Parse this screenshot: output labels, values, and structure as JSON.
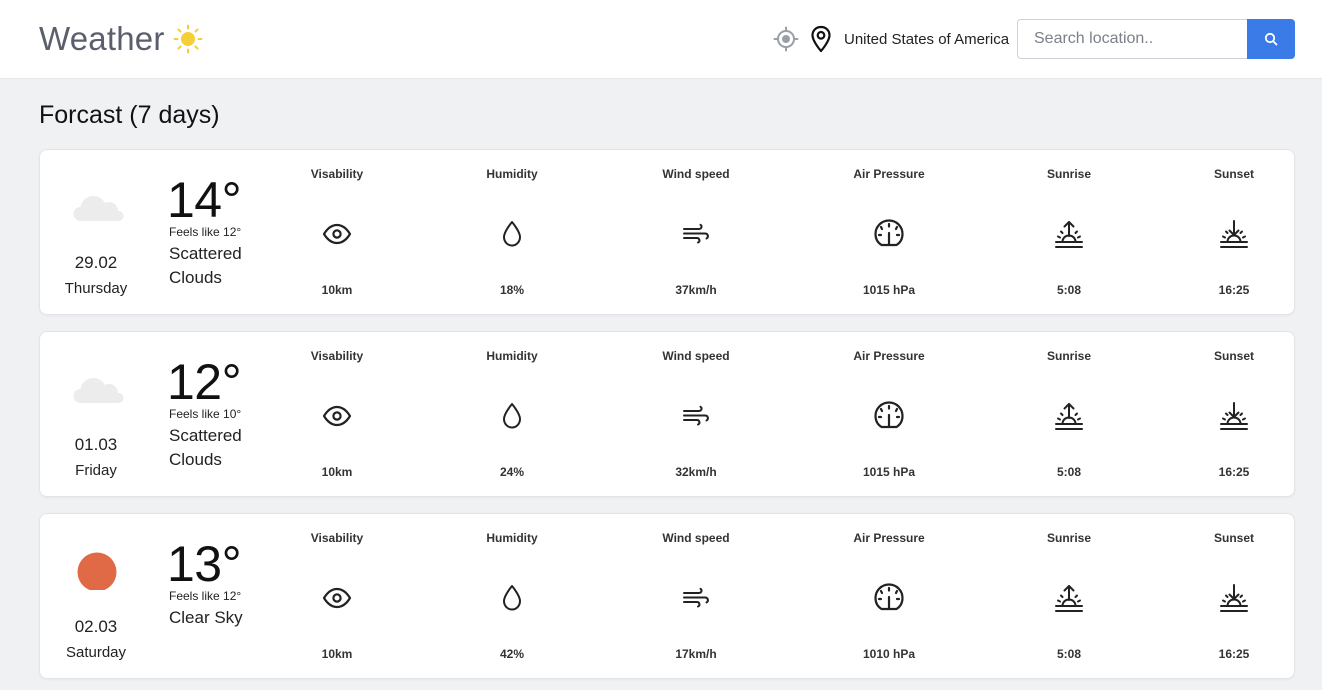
{
  "header": {
    "logo_text": "Weather",
    "country": "United States of America",
    "search_placeholder": "Search location.."
  },
  "section_title": "Forcast (7 days)",
  "stat_labels": {
    "visibility": "Visability",
    "humidity": "Humidity",
    "wind": "Wind speed",
    "pressure": "Air Pressure",
    "sunrise": "Sunrise",
    "sunset": "Sunset"
  },
  "days": [
    {
      "icon": "cloud-icon",
      "date": "29.02",
      "weekday": "Thursday",
      "temp": "14°",
      "feels": "Feels like 12°",
      "condition": "Scattered Clouds",
      "visibility": "10km",
      "humidity": "18%",
      "wind": "37km/h",
      "pressure": "1015 hPa",
      "sunrise": "5:08",
      "sunset": "16:25"
    },
    {
      "icon": "cloud-icon",
      "date": "01.03",
      "weekday": "Friday",
      "temp": "12°",
      "feels": "Feels like 10°",
      "condition": "Scattered Clouds",
      "visibility": "10km",
      "humidity": "24%",
      "wind": "32km/h",
      "pressure": "1015 hPa",
      "sunrise": "5:08",
      "sunset": "16:25"
    },
    {
      "icon": "sun-icon",
      "date": "02.03",
      "weekday": "Saturday",
      "temp": "13°",
      "feels": "Feels like 12°",
      "condition": "Clear Sky",
      "visibility": "10km",
      "humidity": "42%",
      "wind": "17km/h",
      "pressure": "1010 hPa",
      "sunrise": "5:08",
      "sunset": "16:25"
    }
  ],
  "colors": {
    "accent": "#3b7be8",
    "logo_sun": "#f5cf3a",
    "clear_sky_sun": "#e06a45",
    "cloud": "#ececec"
  }
}
